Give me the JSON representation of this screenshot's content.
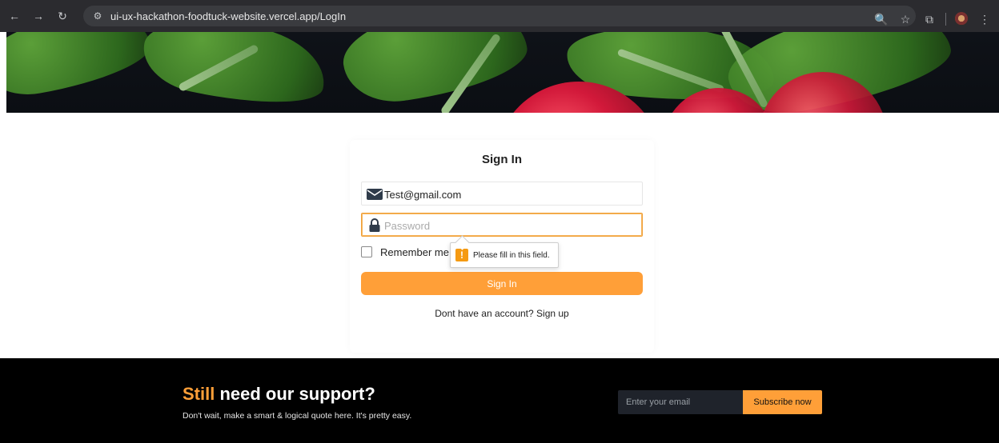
{
  "browser": {
    "url": "ui-ux-hackathon-foodtuck-website.vercel.app/LogIn",
    "icons": {
      "back": "←",
      "forward": "→",
      "reload": "↻",
      "site_settings": "⚙",
      "zoom": "🔍",
      "bookmark": "☆",
      "extensions": "⧉",
      "menu": "⋮"
    }
  },
  "signin": {
    "title": "Sign In",
    "email_value": "Test@gmail.com",
    "password_placeholder": "Password",
    "remember_label": "Remember me",
    "button_label": "Sign In",
    "signup_text": "Dont have an account? Sign up",
    "validation_tooltip": "Please fill in this field."
  },
  "footer": {
    "title_accent": "Still",
    "title_rest": " need our support?",
    "subtitle": "Don't wait, make a smart & logical quote here. It's pretty easy.",
    "email_placeholder": "Enter your email",
    "subscribe_label": "Subscribe now"
  },
  "colors": {
    "accent": "#FF9F38",
    "footer_bg": "#000000",
    "input_focus": "#F0A13A"
  }
}
